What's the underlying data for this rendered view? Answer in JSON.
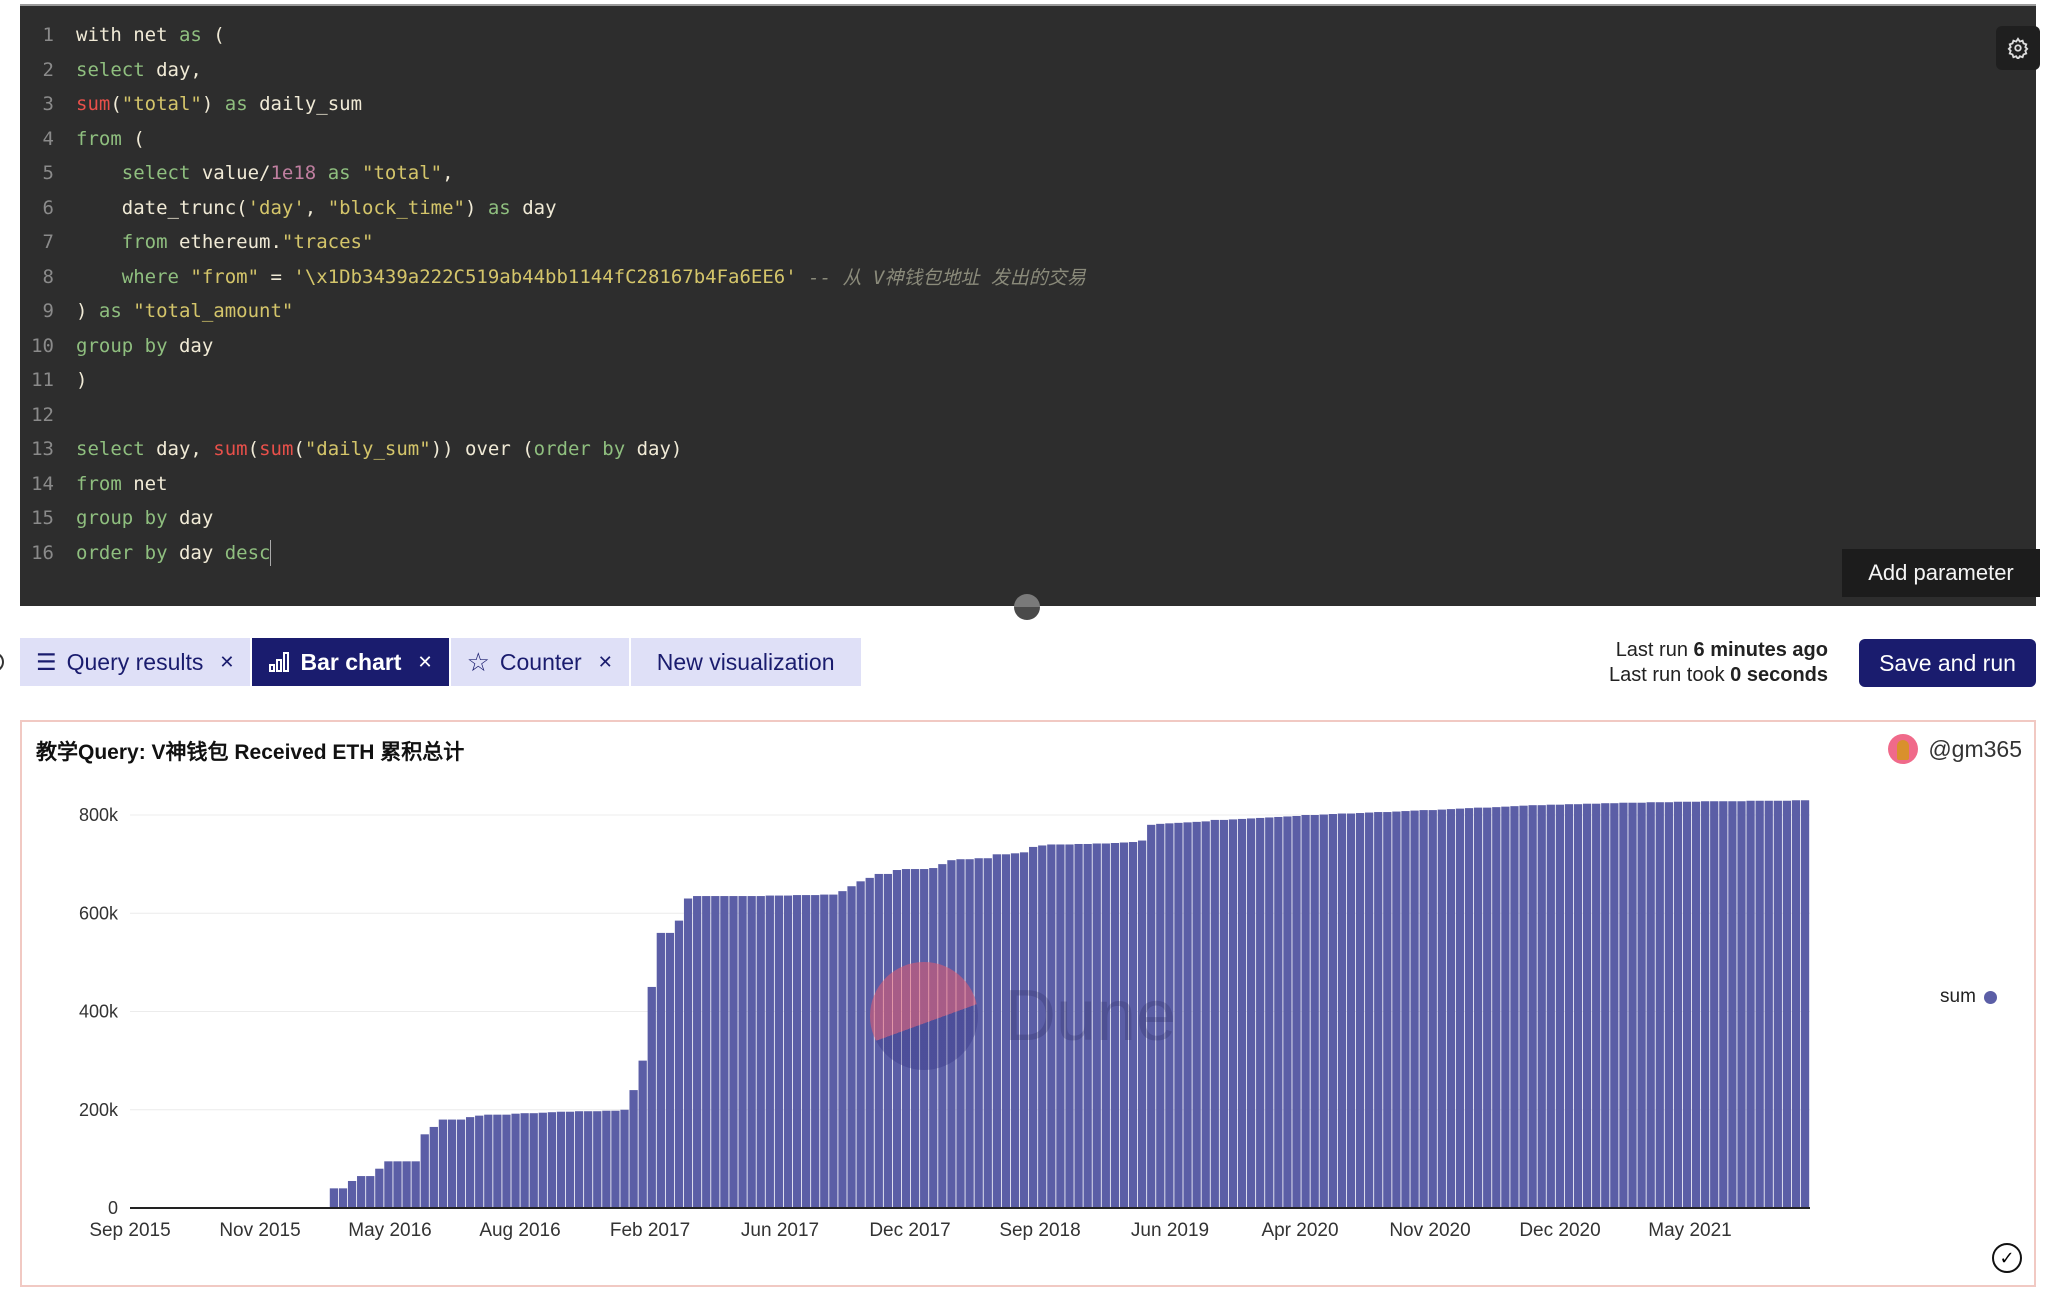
{
  "editor": {
    "lines": [
      [
        [
          "kw-id",
          "with "
        ],
        [
          "id",
          "net "
        ],
        [
          "kw",
          "as "
        ],
        [
          "id",
          "("
        ]
      ],
      [
        [
          "kw",
          "select "
        ],
        [
          "id",
          "day,"
        ]
      ],
      [
        [
          "fn",
          "sum"
        ],
        [
          "id",
          "("
        ],
        [
          "str",
          "\"total\""
        ],
        [
          "id",
          ") "
        ],
        [
          "kw",
          "as "
        ],
        [
          "id",
          "daily_sum"
        ]
      ],
      [
        [
          "kw",
          "from "
        ],
        [
          "id",
          "("
        ]
      ],
      [
        [
          "id",
          "    "
        ],
        [
          "kw",
          "select "
        ],
        [
          "id",
          "value/"
        ],
        [
          "num",
          "1e18"
        ],
        [
          "id",
          " "
        ],
        [
          "kw",
          "as "
        ],
        [
          "str",
          "\"total\""
        ],
        [
          "id",
          ","
        ]
      ],
      [
        [
          "id",
          "    date_trunc("
        ],
        [
          "str",
          "'day'"
        ],
        [
          "id",
          ", "
        ],
        [
          "str",
          "\"block_time\""
        ],
        [
          "id",
          ") "
        ],
        [
          "kw",
          "as "
        ],
        [
          "id",
          "day"
        ]
      ],
      [
        [
          "id",
          "    "
        ],
        [
          "kw",
          "from "
        ],
        [
          "id",
          "ethereum."
        ],
        [
          "str",
          "\"traces\""
        ]
      ],
      [
        [
          "id",
          "    "
        ],
        [
          "kw",
          "where "
        ],
        [
          "str",
          "\"from\""
        ],
        [
          "id",
          " = "
        ],
        [
          "str",
          "'\\x1Db3439a222C519ab44bb1144fC28167b4Fa6EE6'"
        ],
        [
          "id",
          " "
        ],
        [
          "cm",
          "-- 从 V神钱包地址 发出的交易"
        ]
      ],
      [
        [
          "id",
          ") "
        ],
        [
          "kw",
          "as "
        ],
        [
          "str",
          "\"total_amount\""
        ]
      ],
      [
        [
          "kw",
          "group by "
        ],
        [
          "id",
          "day"
        ]
      ],
      [
        [
          "id",
          ")"
        ]
      ],
      [],
      [
        [
          "kw",
          "select "
        ],
        [
          "id",
          "day, "
        ],
        [
          "fn",
          "sum"
        ],
        [
          "id",
          "("
        ],
        [
          "fn",
          "sum"
        ],
        [
          "id",
          "("
        ],
        [
          "str",
          "\"daily_sum\""
        ],
        [
          "id",
          ")) over ("
        ],
        [
          "kw",
          "order by "
        ],
        [
          "id",
          "day)"
        ]
      ],
      [
        [
          "kw",
          "from "
        ],
        [
          "id",
          "net"
        ]
      ],
      [
        [
          "kw",
          "group by "
        ],
        [
          "id",
          "day"
        ]
      ],
      [
        [
          "kw",
          "order by "
        ],
        [
          "id",
          "day "
        ],
        [
          "kw",
          "desc"
        ]
      ]
    ],
    "add_parameter_label": "Add parameter"
  },
  "tabs": [
    {
      "label": "Query results",
      "icon": "list-icon",
      "closable": true,
      "active": false
    },
    {
      "label": "Bar chart",
      "icon": "bar-chart-icon",
      "closable": true,
      "active": true
    },
    {
      "label": "Counter",
      "icon": "star-icon",
      "closable": true,
      "active": false
    },
    {
      "label": "New visualization",
      "icon": "",
      "closable": false,
      "active": false
    }
  ],
  "run_info": {
    "last_run_prefix": "Last run ",
    "last_run_value": "6 minutes ago",
    "took_prefix": "Last run took ",
    "took_value": "0 seconds"
  },
  "save_run_label": "Save and run",
  "viz": {
    "title": "教学Query: V神钱包 Received ETH 累积总计",
    "author": "@gm365",
    "watermark": "Dune"
  },
  "colors": {
    "bar": "#5b5ea6",
    "accent": "#1a1c6e"
  },
  "chart_data": {
    "type": "bar",
    "title": "教学Query: V神钱包 Received ETH 累积总计",
    "xlabel": "",
    "ylabel": "",
    "ylim": [
      0,
      830000
    ],
    "yticks": [
      0,
      200000,
      400000,
      600000,
      800000
    ],
    "ytick_labels": [
      "0",
      "200k",
      "400k",
      "600k",
      "800k"
    ],
    "xtick_labels": [
      "Sep 2015",
      "Nov 2015",
      "May 2016",
      "Aug 2016",
      "Feb 2017",
      "Jun 2017",
      "Dec 2017",
      "Sep 2018",
      "Jun 2019",
      "Apr 2020",
      "Nov 2020",
      "Dec 2020",
      "May 2021"
    ],
    "grid": true,
    "legend": {
      "position": "right",
      "entries": [
        "sum"
      ]
    },
    "series": [
      {
        "name": "sum",
        "values": [
          0,
          0,
          0,
          0,
          0,
          0,
          0,
          0,
          0,
          0,
          0,
          0,
          0,
          2000,
          2000,
          2000,
          2000,
          2000,
          2000,
          2000,
          2000,
          2000,
          40000,
          40000,
          55000,
          65000,
          65000,
          80000,
          95000,
          95000,
          95000,
          95000,
          150000,
          165000,
          180000,
          180000,
          180000,
          185000,
          188000,
          190000,
          190000,
          190000,
          192000,
          193000,
          193000,
          194000,
          195000,
          196000,
          196000,
          197000,
          197000,
          197000,
          198000,
          198000,
          200000,
          240000,
          300000,
          450000,
          560000,
          560000,
          585000,
          630000,
          635000,
          635000,
          635000,
          635000,
          635000,
          635000,
          635000,
          635000,
          636000,
          636000,
          636000,
          637000,
          637000,
          637000,
          638000,
          638000,
          645000,
          655000,
          665000,
          672000,
          680000,
          680000,
          688000,
          690000,
          690000,
          690000,
          692000,
          700000,
          708000,
          710000,
          710000,
          712000,
          712000,
          720000,
          720000,
          722000,
          724000,
          735000,
          738000,
          740000,
          740000,
          740000,
          741000,
          741000,
          742000,
          742000,
          743000,
          744000,
          745000,
          748000,
          780000,
          782000,
          783000,
          784000,
          785000,
          786000,
          787000,
          790000,
          790000,
          791000,
          792000,
          793000,
          794000,
          795000,
          796000,
          797000,
          798000,
          800000,
          800000,
          801000,
          802000,
          803000,
          803000,
          804000,
          805000,
          806000,
          806000,
          807000,
          808000,
          809000,
          810000,
          810000,
          811000,
          812000,
          813000,
          814000,
          815000,
          815000,
          816000,
          817000,
          818000,
          819000,
          820000,
          820000,
          821000,
          821000,
          822000,
          822000,
          823000,
          823000,
          824000,
          824000,
          825000,
          825000,
          825000,
          826000,
          826000,
          826000,
          827000,
          827000,
          827000,
          828000,
          828000,
          828000,
          828000,
          828000,
          829000,
          829000,
          829000,
          829000,
          829000,
          830000,
          830000
        ]
      }
    ]
  }
}
